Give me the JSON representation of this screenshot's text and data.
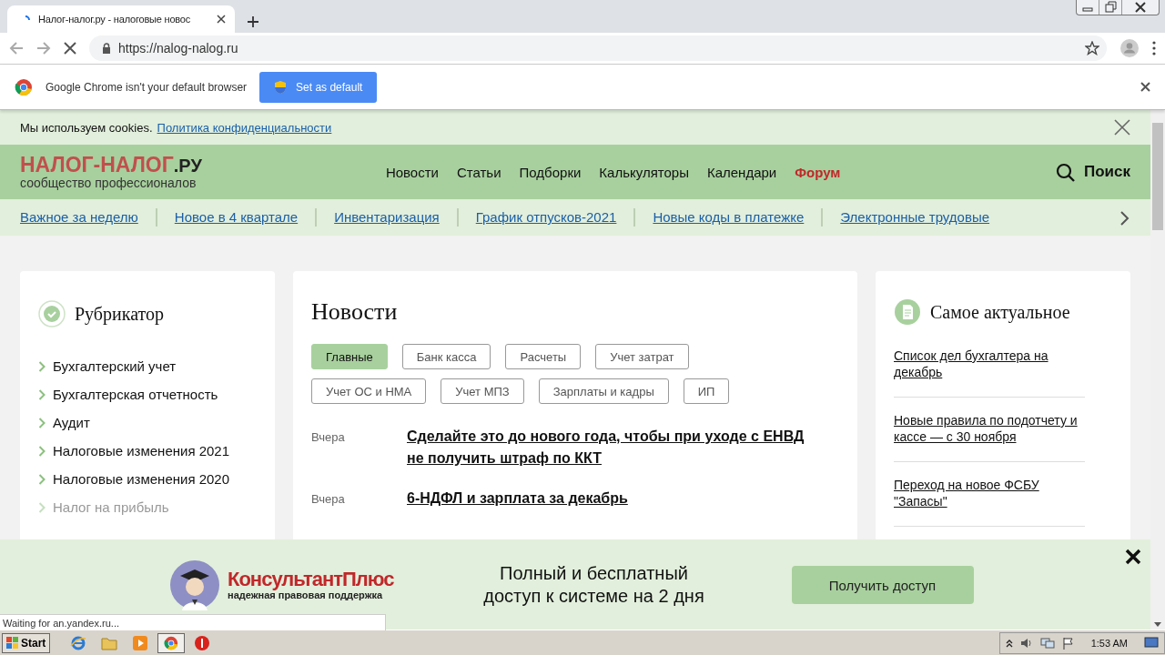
{
  "browser": {
    "tab": {
      "title": "Налог-налог.ру - налоговые новос",
      "selected": true
    },
    "url": "https://nalog-nalog.ru"
  },
  "infobar": {
    "message": "Google Chrome isn't your default browser",
    "button": "Set as default"
  },
  "cookie_notice": {
    "text": "Мы используем cookies.",
    "link": "Политика конфиденциальности"
  },
  "header": {
    "logo": {
      "name": "НАЛОГ-НАЛОГ",
      "tld": ".РУ",
      "tagline": "сообщество профессионалов"
    },
    "nav": [
      {
        "label": "Новости",
        "highlighted": false
      },
      {
        "label": "Статьи",
        "highlighted": false
      },
      {
        "label": "Подборки",
        "highlighted": false
      },
      {
        "label": "Калькуляторы",
        "highlighted": false
      },
      {
        "label": "Календари",
        "highlighted": false
      },
      {
        "label": "Форум",
        "highlighted": true
      }
    ],
    "search": "Поиск"
  },
  "quick_links": [
    "Важное за неделю",
    "Новое в 4 квартале",
    "Инвентаризация",
    "График отпусков-2021",
    "Новые коды в платежке",
    "Электронные трудовые"
  ],
  "rubricator": {
    "title": "Рубрикатор",
    "items": [
      {
        "label": "Бухгалтерский учет",
        "faded": false
      },
      {
        "label": "Бухгалтерская отчетность",
        "faded": false
      },
      {
        "label": "Аудит",
        "faded": false
      },
      {
        "label": "Налоговые изменения 2021",
        "faded": false
      },
      {
        "label": "Налоговые изменения 2020",
        "faded": false
      },
      {
        "label": "Налог на прибыль",
        "faded": true
      }
    ]
  },
  "news": {
    "title": "Новости",
    "filters": [
      {
        "label": "Главные",
        "selected": true
      },
      {
        "label": "Банк касса",
        "selected": false
      },
      {
        "label": "Расчеты",
        "selected": false
      },
      {
        "label": "Учет затрат",
        "selected": false
      },
      {
        "label": "Учет ОС и НМА",
        "selected": false
      },
      {
        "label": "Учет МПЗ",
        "selected": false
      },
      {
        "label": "Зарплаты и кадры",
        "selected": false
      },
      {
        "label": "ИП",
        "selected": false
      }
    ],
    "articles": [
      {
        "date": "Вчера",
        "title": "Сделайте это до нового года, чтобы при уходе с ЕНВД не получить штраф по ККТ"
      },
      {
        "date": "Вчера",
        "title": "6-НДФЛ и зарплата за декабрь"
      }
    ]
  },
  "sidebar": {
    "title": "Самое актуальное",
    "items": [
      "Список дел бухгалтера на декабрь",
      "Новые правила по подотчету и кассе — с 30 ноября",
      "Переход на новое ФСБУ \"Запасы\""
    ]
  },
  "banner": {
    "brand": "КонсультантПлюс",
    "tagline": "надежная правовая поддержка",
    "headline": "Полный и бесплатный доступ к системе на 2 дня",
    "button": "Получить доступ"
  },
  "status": "Waiting for an.yandex.ru...",
  "taskbar": {
    "start": "Start",
    "apps": [
      {
        "kind": "ie",
        "selected": false
      },
      {
        "kind": "folder",
        "selected": false
      },
      {
        "kind": "media",
        "selected": false
      },
      {
        "kind": "chrome",
        "selected": true
      },
      {
        "kind": "stop",
        "selected": false
      }
    ],
    "clock": "1:53 AM"
  }
}
